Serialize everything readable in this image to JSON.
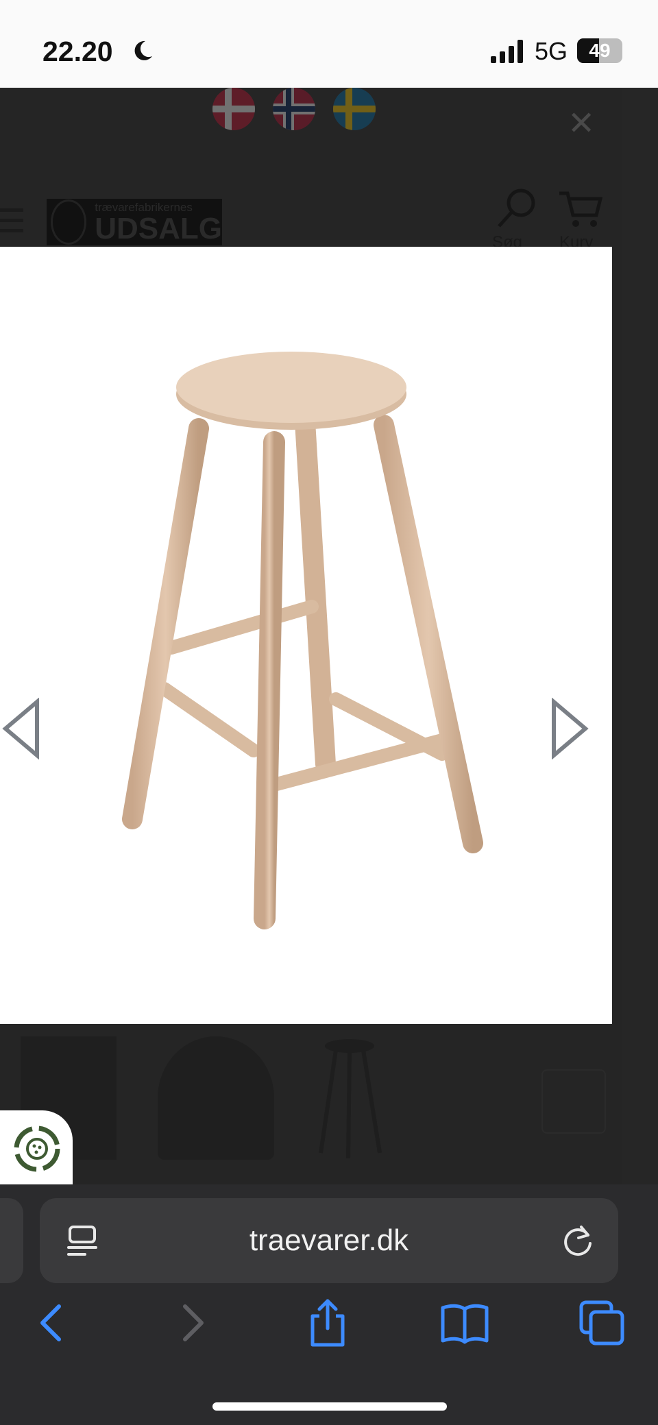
{
  "status_bar": {
    "time": "22.20",
    "network": "5G",
    "battery_level": "49",
    "battery_fraction": 0.49
  },
  "website": {
    "language_flags": [
      "denmark-flag",
      "norway-flag",
      "sweden-flag"
    ],
    "logo": {
      "small_text": "trævarefabrikernes",
      "big_text": "UDSALG"
    },
    "header_actions": [
      {
        "icon": "search-icon",
        "label": "Søg"
      },
      {
        "icon": "cart-icon",
        "label": "Kurv"
      }
    ],
    "product_image_alt": "wooden-bar-stool"
  },
  "browser": {
    "url": "traevarer.dk",
    "toolbar": [
      "back-icon",
      "forward-icon",
      "share-icon",
      "bookmarks-icon",
      "tabs-icon"
    ],
    "accent_color": "#3d8bff"
  }
}
